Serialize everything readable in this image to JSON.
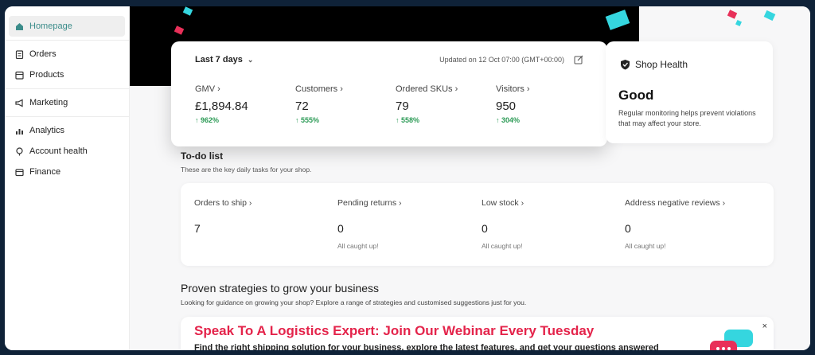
{
  "sidebar": {
    "items": [
      {
        "label": "Homepage",
        "icon": "home-icon"
      },
      {
        "label": "Orders",
        "icon": "clipboard-icon"
      },
      {
        "label": "Products",
        "icon": "box-icon"
      },
      {
        "label": "Marketing",
        "icon": "megaphone-icon"
      },
      {
        "label": "Analytics",
        "icon": "bar-chart-icon"
      },
      {
        "label": "Account health",
        "icon": "health-icon"
      },
      {
        "label": "Finance",
        "icon": "wallet-icon"
      }
    ]
  },
  "metrics": {
    "period": "Last 7 days",
    "updated": "Updated on 12 Oct 07:00 (GMT+00:00)",
    "items": [
      {
        "label": "GMV",
        "value": "£1,894.84",
        "delta": "962%"
      },
      {
        "label": "Customers",
        "value": "72",
        "delta": "555%"
      },
      {
        "label": "Ordered SKUs",
        "value": "79",
        "delta": "558%"
      },
      {
        "label": "Visitors",
        "value": "950",
        "delta": "304%"
      }
    ]
  },
  "health": {
    "title": "Shop Health",
    "status": "Good",
    "description": "Regular monitoring helps prevent violations that may affect your store."
  },
  "todo": {
    "title": "To-do list",
    "subtitle": "These are the key daily tasks for your shop.",
    "tasks": [
      {
        "label": "Orders to ship",
        "count": "7",
        "note": ""
      },
      {
        "label": "Pending returns",
        "count": "0",
        "note": "All caught up!"
      },
      {
        "label": "Low stock",
        "count": "0",
        "note": "All caught up!"
      },
      {
        "label": "Address negative reviews",
        "count": "0",
        "note": "All caught up!"
      }
    ]
  },
  "growth": {
    "title": "Proven strategies to grow your business",
    "subtitle": "Looking for guidance on growing your shop? Explore a range of strategies and customised suggestions just for you."
  },
  "banner": {
    "title": "Speak To A Logistics Expert: Join Our Webinar Every Tuesday",
    "description": "Find the right shipping solution for your business, explore the latest features, and get your questions answered",
    "close": "×"
  },
  "colors": {
    "accent": "#3b8c8a",
    "positive": "#2b9a55",
    "banner_title": "#e4244b",
    "confetti_cyan": "#35d6df",
    "confetti_red": "#e83059"
  }
}
